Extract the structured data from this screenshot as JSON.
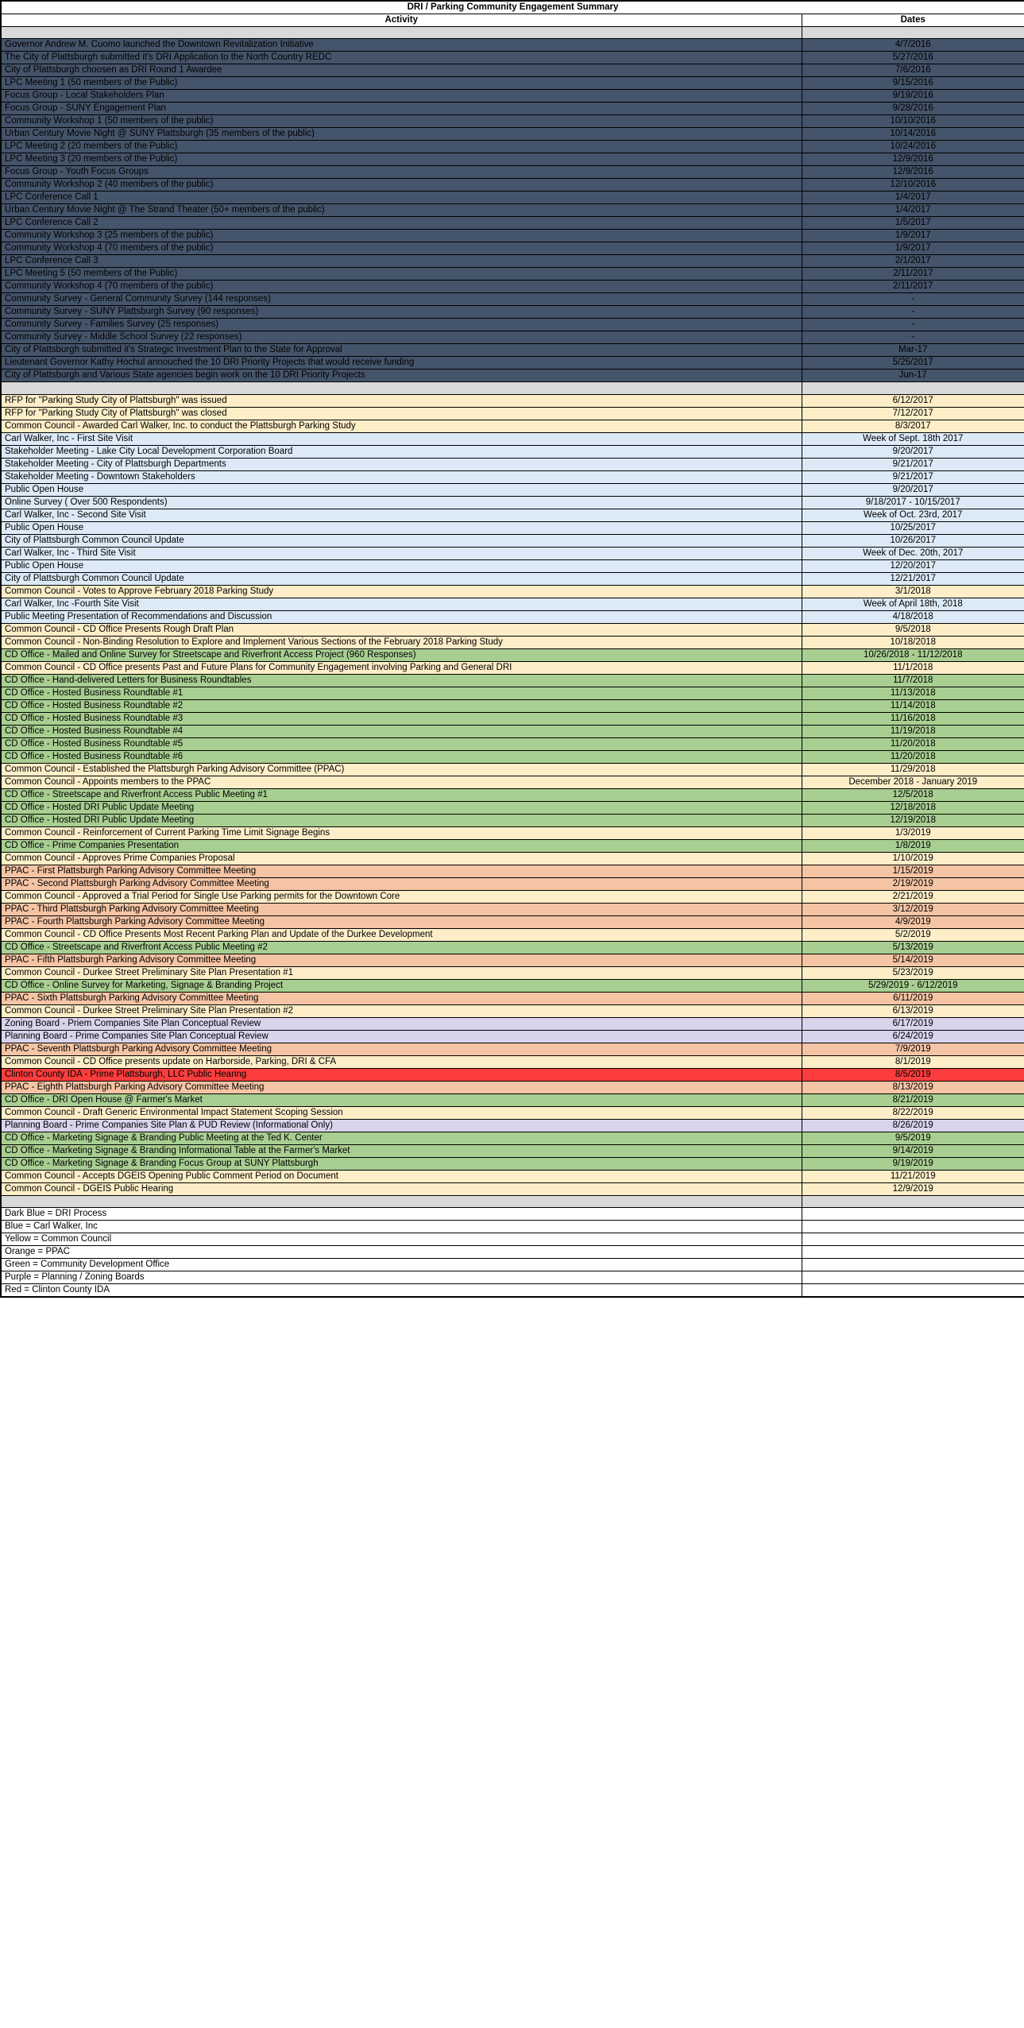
{
  "document": {
    "title": "DRI / Parking Community Engagement Summary",
    "columns": {
      "activity": "Activity",
      "dates": "Dates"
    }
  },
  "colors": {
    "dark_blue": "#44546a",
    "light_blue": "#dceaf7",
    "yellow": "#fdeec8",
    "orange": "#f5c4a4",
    "green": "#a8ce91",
    "purple": "#d9d3ec",
    "red": "#fc3d3d",
    "spacer_gray": "#d9d9d9"
  },
  "rows": [
    {
      "type": "spacer"
    },
    {
      "type": "data",
      "cat": "darkblue",
      "activity": "Governor Andrew M. Cuomo launched the Downtown Revitalization Initiative",
      "dates": "4/7/2016"
    },
    {
      "type": "data",
      "cat": "darkblue",
      "activity": "The City of Plattsburgh submitted it's DRI Application to the North Country REDC",
      "dates": "5/27/2016"
    },
    {
      "type": "data",
      "cat": "darkblue",
      "activity": "City of Plattsburgh choosen as DRI Round 1 Awardee",
      "dates": "7/6/2016"
    },
    {
      "type": "data",
      "cat": "darkblue",
      "activity": "LPC Meeting 1 (50 members of the Public)",
      "dates": "9/15/2016"
    },
    {
      "type": "data",
      "cat": "darkblue",
      "activity": "Focus Group - Local Stakeholders Plan",
      "dates": "9/19/2016"
    },
    {
      "type": "data",
      "cat": "darkblue",
      "activity": "Focus Group - SUNY Engagement Plan",
      "dates": "9/28/2016"
    },
    {
      "type": "data",
      "cat": "darkblue",
      "activity": "Community Workshop 1 (50 members of the public)",
      "dates": "10/10/2016"
    },
    {
      "type": "data",
      "cat": "darkblue",
      "activity": "Urban Century Movie Night @ SUNY Plattsburgh (35 members of the public)",
      "dates": "10/14/2016"
    },
    {
      "type": "data",
      "cat": "darkblue",
      "activity": "LPC Meeting 2 (20 members of the Public)",
      "dates": "10/24/2016"
    },
    {
      "type": "data",
      "cat": "darkblue",
      "activity": "LPC Meeting 3 (20 members of the Public)",
      "dates": "12/9/2016"
    },
    {
      "type": "data",
      "cat": "darkblue",
      "activity": "Focus Group - Youth Focus Groups",
      "dates": "12/9/2016"
    },
    {
      "type": "data",
      "cat": "darkblue",
      "activity": "Community Workshop 2 (40 members of the public)",
      "dates": "12/10/2016"
    },
    {
      "type": "data",
      "cat": "darkblue",
      "activity": "LPC Conference Call 1",
      "dates": "1/4/2017"
    },
    {
      "type": "data",
      "cat": "darkblue",
      "activity": "Urban Century Movie Night @ The Strand Theater (50+ members of the public)",
      "dates": "1/4/2017"
    },
    {
      "type": "data",
      "cat": "darkblue",
      "activity": "LPC Conference Call 2",
      "dates": "1/5/2017"
    },
    {
      "type": "data",
      "cat": "darkblue",
      "activity": "Community Workshop 3 (25 members of the public)",
      "dates": "1/9/2017"
    },
    {
      "type": "data",
      "cat": "darkblue",
      "activity": "Community Workshop 4 (70 members of the public)",
      "dates": "1/9/2017"
    },
    {
      "type": "data",
      "cat": "darkblue",
      "activity": "LPC Conference Call 3",
      "dates": "2/1/2017"
    },
    {
      "type": "data",
      "cat": "darkblue",
      "activity": "LPC Meeting 5 (50 members of the Public)",
      "dates": "2/11/2017"
    },
    {
      "type": "data",
      "cat": "darkblue",
      "activity": "Community Workshop 4 (70 members of the public)",
      "dates": "2/11/2017"
    },
    {
      "type": "data",
      "cat": "darkblue",
      "activity": "Community Survey - General Community Survey (144 responses)",
      "dates": "-"
    },
    {
      "type": "data",
      "cat": "darkblue",
      "activity": "Community Survey - SUNY Plattsburgh Survey (90 responses)",
      "dates": "-"
    },
    {
      "type": "data",
      "cat": "darkblue",
      "activity": "Community Survey - Families Survey (25 responses)",
      "dates": "-"
    },
    {
      "type": "data",
      "cat": "darkblue",
      "activity": "Community Survey - Middle School Survey (22 responses)",
      "dates": "-"
    },
    {
      "type": "data",
      "cat": "darkblue",
      "activity": "City of Plattsburgh submitted it's Strategic Investment Plan to the State for Approval",
      "dates": "Mar-17"
    },
    {
      "type": "data",
      "cat": "darkblue",
      "activity": "Lieutenant Governor Kathy Hochul annouched the 10 DRI Priority Projects that would receive funding",
      "dates": "5/25/2017"
    },
    {
      "type": "data",
      "cat": "darkblue",
      "activity": "City of Plattsburgh and Various State agencies begin work on the 10 DRI Priority Projects",
      "dates": "Jun-17"
    },
    {
      "type": "spacer"
    },
    {
      "type": "data",
      "cat": "yellow",
      "activity": "RFP for \"Parking Study City of Plattsburgh\" was issued",
      "dates": "6/12/2017"
    },
    {
      "type": "data",
      "cat": "yellow",
      "activity": "RFP for \"Parking Study City of Plattsburgh\" was closed",
      "dates": "7/12/2017"
    },
    {
      "type": "data",
      "cat": "yellow",
      "activity": "Common Council - Awarded Carl Walker, Inc. to conduct the Plattsburgh Parking Study",
      "dates": "8/3/2017"
    },
    {
      "type": "data",
      "cat": "lightblue",
      "activity": "Carl Walker, Inc - First Site Visit",
      "dates": "Week of Sept. 18th 2017"
    },
    {
      "type": "data",
      "cat": "lightblue",
      "activity": "Stakeholder Meeting - Lake City Local Development Corporation Board",
      "dates": "9/20/2017"
    },
    {
      "type": "data",
      "cat": "lightblue",
      "activity": "Stakeholder Meeting - City of Plattsburgh Departments",
      "dates": "9/21/2017"
    },
    {
      "type": "data",
      "cat": "lightblue",
      "activity": "Stakeholder Meeting - Downtown Stakeholders",
      "dates": "9/21/2017"
    },
    {
      "type": "data",
      "cat": "lightblue",
      "activity": "Public Open House",
      "dates": "9/20/2017"
    },
    {
      "type": "data",
      "cat": "lightblue",
      "activity": "Online Survey ( Over 500 Respondents)",
      "dates": "9/18/2017 - 10/15/2017"
    },
    {
      "type": "data",
      "cat": "lightblue",
      "activity": "Carl Walker, Inc - Second Site Visit",
      "dates": "Week of Oct. 23rd, 2017"
    },
    {
      "type": "data",
      "cat": "lightblue",
      "activity": "Public Open House",
      "dates": "10/25/2017"
    },
    {
      "type": "data",
      "cat": "lightblue",
      "activity": "City of Plattsburgh Common Council Update",
      "dates": "10/26/2017"
    },
    {
      "type": "data",
      "cat": "lightblue",
      "activity": "Carl Walker, Inc - Third Site Visit",
      "dates": "Week of Dec. 20th, 2017"
    },
    {
      "type": "data",
      "cat": "lightblue",
      "activity": "Public Open House",
      "dates": "12/20/2017"
    },
    {
      "type": "data",
      "cat": "lightblue",
      "activity": "City of Plattsburgh Common Council Update",
      "dates": "12/21/2017"
    },
    {
      "type": "data",
      "cat": "yellow",
      "activity": "Common Council - Votes to Approve February 2018 Parking Study",
      "dates": "3/1/2018"
    },
    {
      "type": "data",
      "cat": "lightblue",
      "activity": "Carl Walker, Inc -Fourth Site Visit",
      "dates": "Week of April 18th, 2018"
    },
    {
      "type": "data",
      "cat": "lightblue",
      "activity": "Public Meeting Presentation of Recommendations and Discussion",
      "dates": "4/18/2018"
    },
    {
      "type": "data",
      "cat": "yellow",
      "activity": "Common Council - CD Office Presents Rough Draft Plan",
      "dates": "9/5/2018"
    },
    {
      "type": "data",
      "cat": "yellow",
      "activity": "Common Council - Non-Binding Resolution to Explore and Implement Various Sections of the February 2018 Parking Study",
      "dates": "10/18/2018"
    },
    {
      "type": "data",
      "cat": "green",
      "activity": "CD Office - Mailed and Online Survey for Streetscape and Riverfront Access Project (960 Responses)",
      "dates": "10/26/2018 - 11/12/2018"
    },
    {
      "type": "data",
      "cat": "yellow",
      "activity": "Common Council - CD Office presents Past and Future Plans for Community Engagement involving Parking and General DRI",
      "dates": "11/1/2018"
    },
    {
      "type": "data",
      "cat": "green",
      "activity": "CD Office - Hand-delivered Letters for Business Roundtables",
      "dates": "11/7/2018"
    },
    {
      "type": "data",
      "cat": "green",
      "activity": "CD Office - Hosted Business Roundtable #1",
      "dates": "11/13/2018"
    },
    {
      "type": "data",
      "cat": "green",
      "activity": "CD Office - Hosted Business Roundtable #2",
      "dates": "11/14/2018"
    },
    {
      "type": "data",
      "cat": "green",
      "activity": "CD Office - Hosted Business Roundtable #3",
      "dates": "11/16/2018"
    },
    {
      "type": "data",
      "cat": "green",
      "activity": "CD Office - Hosted Business Roundtable #4",
      "dates": "11/19/2018"
    },
    {
      "type": "data",
      "cat": "green",
      "activity": "CD Office - Hosted Business Roundtable #5",
      "dates": "11/20/2018"
    },
    {
      "type": "data",
      "cat": "green",
      "activity": "CD Office - Hosted Business Roundtable #6",
      "dates": "11/20/2018"
    },
    {
      "type": "data",
      "cat": "yellow",
      "activity": "Common Council - Established the Plattsburgh Parking Advisory Committee (PPAC)",
      "dates": "11/29/2018"
    },
    {
      "type": "data",
      "cat": "yellow",
      "activity": "Common Council - Appoints members to the PPAC",
      "dates": "December 2018 - January 2019"
    },
    {
      "type": "data",
      "cat": "green",
      "activity": "CD Office - Streetscape and Riverfront Access Public Meeting #1",
      "dates": "12/5/2018"
    },
    {
      "type": "data",
      "cat": "green",
      "activity": "CD Office - Hosted DRI Public Update Meeting",
      "dates": "12/18/2018"
    },
    {
      "type": "data",
      "cat": "green",
      "activity": "CD Office - Hosted DRI Public Update Meeting",
      "dates": "12/19/2018"
    },
    {
      "type": "data",
      "cat": "yellow",
      "activity": "Common Council - Reinforcement of Current Parking Time Limit Signage Begins",
      "dates": "1/3/2019"
    },
    {
      "type": "data",
      "cat": "green",
      "activity": "CD Office - Prime Companies Presentation",
      "dates": "1/8/2019"
    },
    {
      "type": "data",
      "cat": "yellow",
      "activity": "Common Council - Approves Prime Companies Proposal",
      "dates": "1/10/2019"
    },
    {
      "type": "data",
      "cat": "orange",
      "activity": "PPAC - First Plattsburgh Parking Advisory Committee Meeting",
      "dates": "1/15/2019"
    },
    {
      "type": "data",
      "cat": "orange",
      "activity": "PPAC - Second Plattsburgh Parking Advisory Committee Meeting",
      "dates": "2/19/2019"
    },
    {
      "type": "data",
      "cat": "yellow",
      "activity": "Common Council - Approved a Trial Period for Single Use Parking permits for the Downtown Core",
      "dates": "2/21/2019"
    },
    {
      "type": "data",
      "cat": "orange",
      "activity": "PPAC - Third Plattsburgh Parking Advisory Committee Meeting",
      "dates": "3/12/2019"
    },
    {
      "type": "data",
      "cat": "orange",
      "activity": "PPAC - Fourth Plattsburgh Parking Advisory Committee Meeting",
      "dates": "4/9/2019"
    },
    {
      "type": "data",
      "cat": "yellow",
      "activity": "Common Council - CD Office Presents Most Recent Parking Plan and Update of the Durkee Development",
      "dates": "5/2/2019"
    },
    {
      "type": "data",
      "cat": "green",
      "activity": "CD Office - Streetscape and Riverfront Access Public Meeting #2",
      "dates": "5/13/2019"
    },
    {
      "type": "data",
      "cat": "orange",
      "activity": "PPAC - Fifth Plattsburgh Parking Advisory Committee Meeting",
      "dates": "5/14/2019"
    },
    {
      "type": "data",
      "cat": "yellow",
      "activity": "Common Council - Durkee Street Preliminary Site Plan Presentation #1",
      "dates": "5/23/2019"
    },
    {
      "type": "data",
      "cat": "green",
      "activity": "CD Office - Online Survey for Marketing, Signage & Branding Project",
      "dates": "5/29/2019 - 6/12/2019"
    },
    {
      "type": "data",
      "cat": "orange",
      "activity": "PPAC - Sixth Plattsburgh Parking Advisory Committee Meeting",
      "dates": "6/11/2019"
    },
    {
      "type": "data",
      "cat": "yellow",
      "activity": "Common Council - Durkee Street Preliminary Site Plan Presentation #2",
      "dates": "6/13/2019"
    },
    {
      "type": "data",
      "cat": "purple",
      "activity": "Zoning Board - Priem Companies Site Plan Conceptual Review",
      "dates": "6/17/2019"
    },
    {
      "type": "data",
      "cat": "purple",
      "activity": "Planning Board - Prime Companies Site Plan Conceptual Review",
      "dates": "6/24/2019"
    },
    {
      "type": "data",
      "cat": "orange",
      "activity": "PPAC - Seventh Plattsburgh Parking Advisory Committee Meeting",
      "dates": "7/9/2019"
    },
    {
      "type": "data",
      "cat": "yellow",
      "activity": "Common Council - CD Office presents update on Harborside, Parking, DRI & CFA",
      "dates": "8/1/2019"
    },
    {
      "type": "data",
      "cat": "red",
      "activity": "Clinton County IDA - Prime Plattsburgh, LLC Public Hearing",
      "dates": "8/5/2019"
    },
    {
      "type": "data",
      "cat": "orange",
      "activity": "PPAC - Eighth Plattsburgh Parking Advisory Committee Meeting",
      "dates": "8/13/2019"
    },
    {
      "type": "data",
      "cat": "green",
      "activity": "CD Office - DRI Open House @ Farmer's Market",
      "dates": "8/21/2019"
    },
    {
      "type": "data",
      "cat": "yellow",
      "activity": "Common Council - Draft Generic Environmental Impact Statement Scoping Session",
      "dates": "8/22/2019"
    },
    {
      "type": "data",
      "cat": "purple",
      "activity": "Planning Board - Prime Companies Site Plan & PUD Review (Informational Only)",
      "dates": "8/26/2019"
    },
    {
      "type": "data",
      "cat": "green",
      "activity": "CD Office - Marketing Signage & Branding Public Meeting at the Ted K. Center",
      "dates": "9/5/2019"
    },
    {
      "type": "data",
      "cat": "green",
      "activity": "CD Office - Marketing Signage & Branding Informational Table at the Farmer's Market",
      "dates": "9/14/2019"
    },
    {
      "type": "data",
      "cat": "green",
      "activity": "CD Office - Marketing Signage & Branding Focus Group at SUNY Plattsburgh",
      "dates": "9/19/2019"
    },
    {
      "type": "data",
      "cat": "yellow",
      "activity": "Common Council - Accepts DGEIS Opening Public Comment Period on Document",
      "dates": "11/21/2019"
    },
    {
      "type": "data",
      "cat": "yellow",
      "activity": "Common Council - DGEIS Public Hearing",
      "dates": "12/9/2019"
    },
    {
      "type": "spacer"
    }
  ],
  "legend": [
    {
      "label": "Dark Blue =  DRI Process"
    },
    {
      "label": "Blue = Carl Walker, Inc"
    },
    {
      "label": "Yellow = Common Council"
    },
    {
      "label": "Orange = PPAC"
    },
    {
      "label": "Green = Community Development Office"
    },
    {
      "label": "Purple = Planning / Zoning Boards"
    },
    {
      "label": "Red  = Clinton County IDA"
    }
  ]
}
